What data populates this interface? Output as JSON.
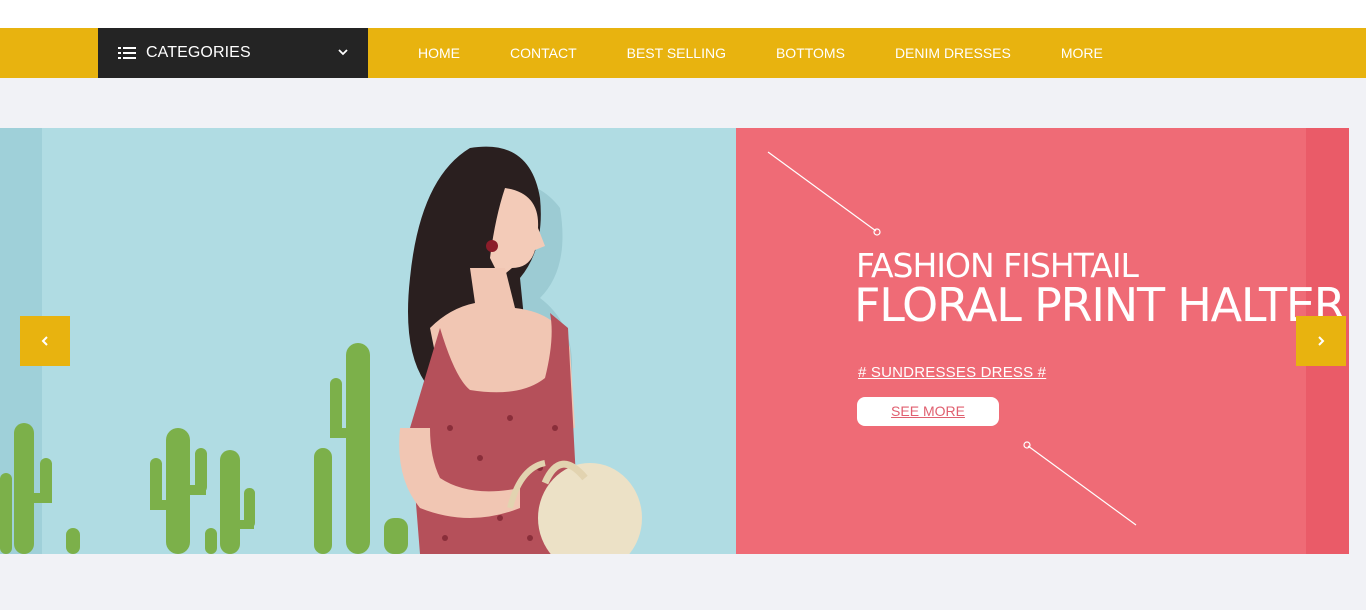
{
  "nav": {
    "categories_label": "CATEGORIES",
    "menu": [
      {
        "label": "HOME"
      },
      {
        "label": "CONTACT"
      },
      {
        "label": "BEST SELLING"
      },
      {
        "label": "BOTTOMS"
      },
      {
        "label": "DENIM DRESSES"
      },
      {
        "label": "MORE"
      }
    ]
  },
  "banner": {
    "headline_1": "FASHION FISHTAIL",
    "headline_2": "FLORAL PRINT HALTER",
    "tagline": "# SUNDRESSES DRESS #",
    "cta_label": "SEE MORE"
  },
  "colors": {
    "accent": "#e8b30f",
    "dark": "#242424",
    "panel": "#ef6b76",
    "photo_bg": "#b0dce3"
  },
  "icons": {
    "categories": "list-icon",
    "dropdown": "chevron-down-icon",
    "prev": "chevron-left-icon",
    "next": "chevron-right-icon"
  }
}
